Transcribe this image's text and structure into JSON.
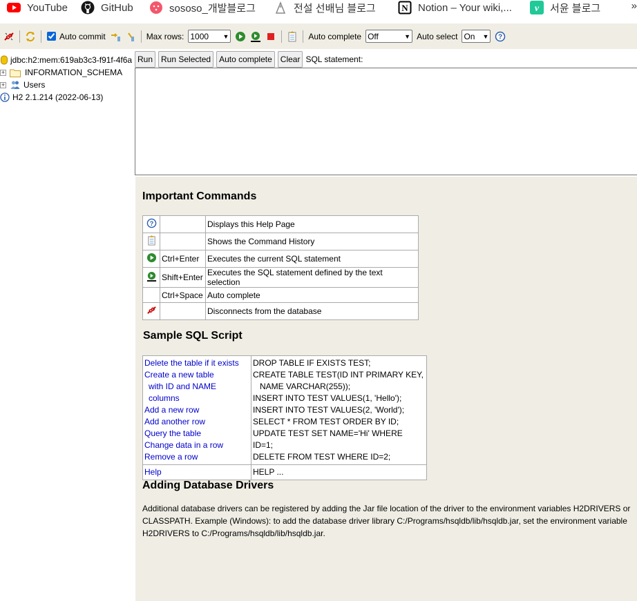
{
  "bookmarks": [
    {
      "label": "YouTube",
      "icon": "youtube-icon",
      "color": "#ff0000"
    },
    {
      "label": "GitHub",
      "icon": "github-icon",
      "color": "#181717"
    },
    {
      "label": "sososo_개발블로그",
      "icon": "sososo-blog-icon",
      "color": "#f5566c"
    },
    {
      "label": "전설 선배님 블로그",
      "icon": "legend-blog-icon",
      "color": "#888888"
    },
    {
      "label": "Notion – Your wiki,...",
      "icon": "notion-icon",
      "color": "#000000"
    },
    {
      "label": "서윤 블로그",
      "icon": "velog-icon",
      "color": "#20c997"
    }
  ],
  "bookmarks_more": "»",
  "toolbar": {
    "auto_commit_label": "Auto commit",
    "auto_commit_checked": true,
    "max_rows_label": "Max rows:",
    "max_rows_value": "1000",
    "auto_complete_label": "Auto complete",
    "auto_complete_value": "Off",
    "auto_select_label": "Auto select",
    "auto_select_value": "On"
  },
  "tree": {
    "connection": "jdbc:h2:mem:619ab3c3-f91f-4f6a",
    "items": [
      "INFORMATION_SCHEMA",
      "Users"
    ],
    "version": "H2 2.1.214 (2022-06-13)"
  },
  "query": {
    "run": "Run",
    "run_selected": "Run Selected",
    "auto_complete": "Auto complete",
    "clear": "Clear",
    "sql_label": "SQL statement:",
    "sql_value": ""
  },
  "help": {
    "important_title": "Important Commands",
    "commands": [
      {
        "icon": "help-icon",
        "key": "",
        "desc": "Displays this Help Page"
      },
      {
        "icon": "history-icon",
        "key": "",
        "desc": "Shows the Command History"
      },
      {
        "icon": "run-icon",
        "key": "Ctrl+Enter",
        "desc": "Executes the current SQL statement"
      },
      {
        "icon": "run-selected-icon",
        "key": "Shift+Enter",
        "desc": "Executes the SQL statement defined by the text selection"
      },
      {
        "icon": "",
        "key": "Ctrl+Space",
        "desc": "Auto complete"
      },
      {
        "icon": "disconnect-icon",
        "key": "",
        "desc": "Disconnects from the database"
      }
    ],
    "sample_title": "Sample SQL Script",
    "sample": [
      {
        "link": "Delete the table if it exists",
        "sql": "DROP TABLE IF EXISTS TEST;"
      },
      {
        "link": "Create a new table",
        "sql": "CREATE TABLE TEST(ID INT PRIMARY KEY,"
      },
      {
        "link": "with ID and NAME columns",
        "sql": "NAME VARCHAR(255));",
        "indent": true
      },
      {
        "link": "Add a new row",
        "sql": "INSERT INTO TEST VALUES(1, 'Hello');"
      },
      {
        "link": "Add another row",
        "sql": "INSERT INTO TEST VALUES(2, 'World');"
      },
      {
        "link": "Query the table",
        "sql": "SELECT * FROM TEST ORDER BY ID;"
      },
      {
        "link": "Change data in a row",
        "sql": "UPDATE TEST SET NAME='Hi' WHERE ID=1;"
      },
      {
        "link": "Remove a row",
        "sql": "DELETE FROM TEST WHERE ID=2;"
      }
    ],
    "sample_help": {
      "link": "Help",
      "sql": "HELP ..."
    },
    "drivers_title": "Adding Database Drivers",
    "drivers_text": "Additional database drivers can be registered by adding the Jar file location of the driver to the environment variables H2DRIVERS or CLASSPATH. Example (Windows): to add the database driver library C:/Programs/hsqldb/lib/hsqldb.jar, set the environment variable H2DRIVERS to C:/Programs/hsqldb/lib/hsqldb.jar."
  }
}
